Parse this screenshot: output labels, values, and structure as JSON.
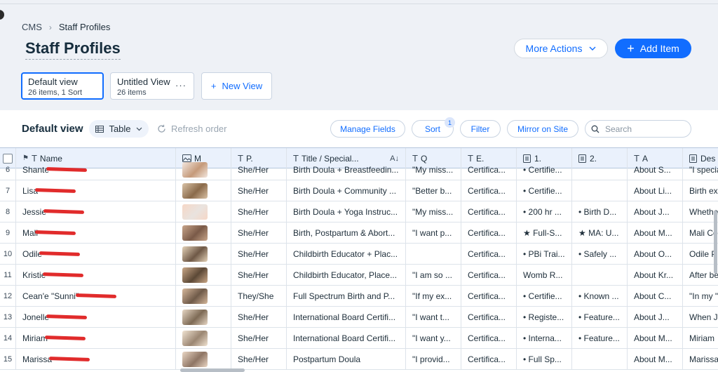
{
  "breadcrumb": {
    "root": "CMS",
    "current": "Staff Profiles"
  },
  "page_title": "Staff Profiles",
  "header_buttons": {
    "more_actions": "More Actions",
    "add_item": "Add Item"
  },
  "views": [
    {
      "name": "Default view",
      "sub": "26 items, 1 Sort",
      "selected": true
    },
    {
      "name": "Untitled View",
      "sub": "26 items",
      "selected": false
    }
  ],
  "new_view": "New View",
  "toolbar": {
    "view_label": "Default view",
    "table_select": "Table",
    "refresh": "Refresh order",
    "manage_fields": "Manage Fields",
    "sort": "Sort",
    "sort_count": "1",
    "filter": "Filter",
    "mirror": "Mirror on Site",
    "search_placeholder": "Search"
  },
  "columns": [
    "Name",
    "M",
    "P.",
    "Title / Special...",
    "Q",
    "E.",
    "1.",
    "2.",
    "A",
    "Des"
  ],
  "rows": [
    {
      "n": "6",
      "name": "Shante",
      "pron": "She/Her",
      "title": "Birth Doula + Breastfeedin...",
      "q": "\"My miss...",
      "e": "Certifica...",
      "c1": "• Certifie...",
      "c2": "",
      "a": "About S...",
      "d": "\"I specia"
    },
    {
      "n": "7",
      "name": "Lisa",
      "pron": "She/Her",
      "title": "Birth Doula + Community ...",
      "q": "\"Better b...",
      "e": "Certifica...",
      "c1": "• Certifie...",
      "c2": "",
      "a": "About Li...",
      "d": "Birth ex"
    },
    {
      "n": "8",
      "name": "Jessie",
      "pron": "She/Her",
      "title": "Birth Doula + Yoga Instruc...",
      "q": "\"My miss...",
      "e": "Certifica...",
      "c1": "• 200 hr ...",
      "c2": "• Birth D...",
      "a": "About J...",
      "d": "Whethe"
    },
    {
      "n": "9",
      "name": "Mali",
      "pron": "She/Her",
      "title": "Birth, Postpartum & Abort...",
      "q": "\"I want p...",
      "e": "Certifica...",
      "c1": "★ Full-S...",
      "c2": "★ MA: U...",
      "a": "About M...",
      "d": "Mali Co"
    },
    {
      "n": "10",
      "name": "Odile",
      "pron": "She/Her",
      "title": "Childbirth Educator + Plac...",
      "q": "",
      "e": "Certifica...",
      "c1": "• PBi Trai...",
      "c2": "• Safely ...",
      "a": "About O...",
      "d": "Odile P"
    },
    {
      "n": "11",
      "name": "Kristie",
      "pron": "She/Her",
      "title": "Childbirth Educator, Place...",
      "q": "\"I am so ...",
      "e": "Certifica...",
      "c1": "Womb R...",
      "c2": "",
      "a": "About Kr...",
      "d": "After be"
    },
    {
      "n": "12",
      "name": "Cean'e \"Sunni\"",
      "pron": "They/She",
      "title": "Full Spectrum Birth and P...",
      "q": "\"If my ex...",
      "e": "Certifica...",
      "c1": "• Certifie...",
      "c2": "• Known ...",
      "a": "About C...",
      "d": "\"In my \""
    },
    {
      "n": "13",
      "name": "Jonelle",
      "pron": "She/Her",
      "title": "International Board Certifi...",
      "q": "\"I want t...",
      "e": "Certifica...",
      "c1": "• Registe...",
      "c2": "• Feature...",
      "a": "About J...",
      "d": "When J"
    },
    {
      "n": "14",
      "name": "Miriam",
      "pron": "She/Her",
      "title": "International Board Certifi...",
      "q": "\"I want y...",
      "e": "Certifica...",
      "c1": "• Interna...",
      "c2": "• Feature...",
      "a": "About M...",
      "d": "Miriam"
    },
    {
      "n": "15",
      "name": "Marissa",
      "pron": "She/Her",
      "title": "Postpartum Doula",
      "q": "\"I provid...",
      "e": "Certifica...",
      "c1": "• Full Sp...",
      "c2": "",
      "a": "About M...",
      "d": "Marissa"
    }
  ],
  "colors": {
    "accent": "#116dff",
    "header_bg": "#eaf1fc",
    "redaction": "#e12b2b"
  }
}
